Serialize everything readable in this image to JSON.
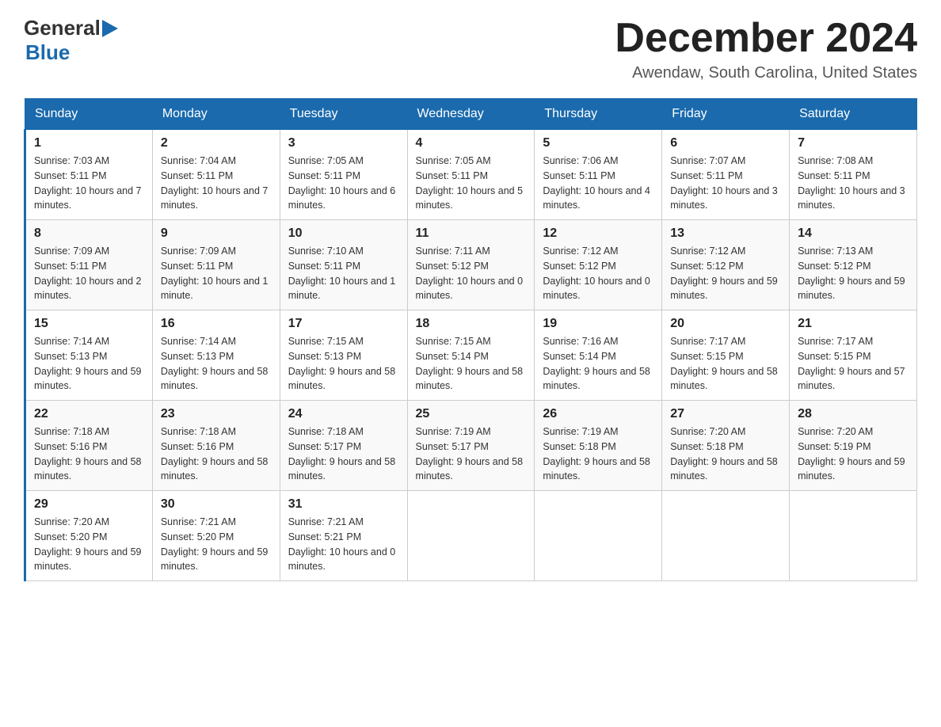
{
  "header": {
    "logo_general": "General",
    "logo_blue": "Blue",
    "month_title": "December 2024",
    "location": "Awendaw, South Carolina, United States"
  },
  "days_of_week": [
    "Sunday",
    "Monday",
    "Tuesday",
    "Wednesday",
    "Thursday",
    "Friday",
    "Saturday"
  ],
  "weeks": [
    [
      {
        "day": "1",
        "sunrise": "7:03 AM",
        "sunset": "5:11 PM",
        "daylight": "10 hours and 7 minutes."
      },
      {
        "day": "2",
        "sunrise": "7:04 AM",
        "sunset": "5:11 PM",
        "daylight": "10 hours and 7 minutes."
      },
      {
        "day": "3",
        "sunrise": "7:05 AM",
        "sunset": "5:11 PM",
        "daylight": "10 hours and 6 minutes."
      },
      {
        "day": "4",
        "sunrise": "7:05 AM",
        "sunset": "5:11 PM",
        "daylight": "10 hours and 5 minutes."
      },
      {
        "day": "5",
        "sunrise": "7:06 AM",
        "sunset": "5:11 PM",
        "daylight": "10 hours and 4 minutes."
      },
      {
        "day": "6",
        "sunrise": "7:07 AM",
        "sunset": "5:11 PM",
        "daylight": "10 hours and 3 minutes."
      },
      {
        "day": "7",
        "sunrise": "7:08 AM",
        "sunset": "5:11 PM",
        "daylight": "10 hours and 3 minutes."
      }
    ],
    [
      {
        "day": "8",
        "sunrise": "7:09 AM",
        "sunset": "5:11 PM",
        "daylight": "10 hours and 2 minutes."
      },
      {
        "day": "9",
        "sunrise": "7:09 AM",
        "sunset": "5:11 PM",
        "daylight": "10 hours and 1 minute."
      },
      {
        "day": "10",
        "sunrise": "7:10 AM",
        "sunset": "5:11 PM",
        "daylight": "10 hours and 1 minute."
      },
      {
        "day": "11",
        "sunrise": "7:11 AM",
        "sunset": "5:12 PM",
        "daylight": "10 hours and 0 minutes."
      },
      {
        "day": "12",
        "sunrise": "7:12 AM",
        "sunset": "5:12 PM",
        "daylight": "10 hours and 0 minutes."
      },
      {
        "day": "13",
        "sunrise": "7:12 AM",
        "sunset": "5:12 PM",
        "daylight": "9 hours and 59 minutes."
      },
      {
        "day": "14",
        "sunrise": "7:13 AM",
        "sunset": "5:12 PM",
        "daylight": "9 hours and 59 minutes."
      }
    ],
    [
      {
        "day": "15",
        "sunrise": "7:14 AM",
        "sunset": "5:13 PM",
        "daylight": "9 hours and 59 minutes."
      },
      {
        "day": "16",
        "sunrise": "7:14 AM",
        "sunset": "5:13 PM",
        "daylight": "9 hours and 58 minutes."
      },
      {
        "day": "17",
        "sunrise": "7:15 AM",
        "sunset": "5:13 PM",
        "daylight": "9 hours and 58 minutes."
      },
      {
        "day": "18",
        "sunrise": "7:15 AM",
        "sunset": "5:14 PM",
        "daylight": "9 hours and 58 minutes."
      },
      {
        "day": "19",
        "sunrise": "7:16 AM",
        "sunset": "5:14 PM",
        "daylight": "9 hours and 58 minutes."
      },
      {
        "day": "20",
        "sunrise": "7:17 AM",
        "sunset": "5:15 PM",
        "daylight": "9 hours and 58 minutes."
      },
      {
        "day": "21",
        "sunrise": "7:17 AM",
        "sunset": "5:15 PM",
        "daylight": "9 hours and 57 minutes."
      }
    ],
    [
      {
        "day": "22",
        "sunrise": "7:18 AM",
        "sunset": "5:16 PM",
        "daylight": "9 hours and 58 minutes."
      },
      {
        "day": "23",
        "sunrise": "7:18 AM",
        "sunset": "5:16 PM",
        "daylight": "9 hours and 58 minutes."
      },
      {
        "day": "24",
        "sunrise": "7:18 AM",
        "sunset": "5:17 PM",
        "daylight": "9 hours and 58 minutes."
      },
      {
        "day": "25",
        "sunrise": "7:19 AM",
        "sunset": "5:17 PM",
        "daylight": "9 hours and 58 minutes."
      },
      {
        "day": "26",
        "sunrise": "7:19 AM",
        "sunset": "5:18 PM",
        "daylight": "9 hours and 58 minutes."
      },
      {
        "day": "27",
        "sunrise": "7:20 AM",
        "sunset": "5:18 PM",
        "daylight": "9 hours and 58 minutes."
      },
      {
        "day": "28",
        "sunrise": "7:20 AM",
        "sunset": "5:19 PM",
        "daylight": "9 hours and 59 minutes."
      }
    ],
    [
      {
        "day": "29",
        "sunrise": "7:20 AM",
        "sunset": "5:20 PM",
        "daylight": "9 hours and 59 minutes."
      },
      {
        "day": "30",
        "sunrise": "7:21 AM",
        "sunset": "5:20 PM",
        "daylight": "9 hours and 59 minutes."
      },
      {
        "day": "31",
        "sunrise": "7:21 AM",
        "sunset": "5:21 PM",
        "daylight": "10 hours and 0 minutes."
      },
      null,
      null,
      null,
      null
    ]
  ],
  "labels": {
    "sunrise": "Sunrise:",
    "sunset": "Sunset:",
    "daylight": "Daylight:"
  }
}
